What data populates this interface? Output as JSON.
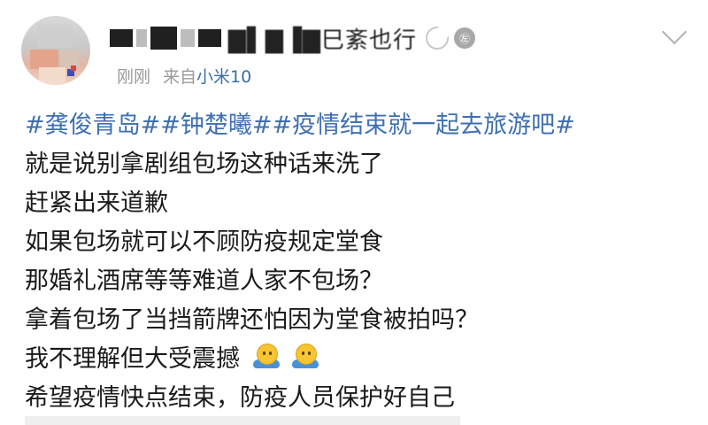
{
  "post": {
    "author": {
      "display_name": "▇▌▇▐▇巳紊也行",
      "avatar_icon": "avatar-icon"
    },
    "badges": [
      "moon-badge-icon",
      "medal-badge-icon"
    ],
    "medal_label": "㊧",
    "menu_icon": "chevron-down-icon",
    "time": "刚刚",
    "source_prefix": "来自",
    "source_device": "小米10",
    "hashtags": "#龚俊青岛##钟楚曦##疫情结束就一起去旅游吧#",
    "lines": [
      "就是说别拿剧组包场这种话来洗了",
      "赶紧出来道歉",
      "如果包场就可以不顾防疫规定堂食",
      "那婚礼酒席等等难道人家不包场？",
      "拿着包场了当挡箭牌还怕因为堂食被拍吗？",
      "我不理解但大受震撼",
      "希望疫情快点结束，防疫人员保护好自己"
    ],
    "emoji": [
      "shrug-emoji-icon",
      "shrug-emoji-icon"
    ]
  },
  "colors": {
    "hashtag": "#3f6fb0",
    "device_link": "#3a6ea5",
    "meta_text": "#9a9a9a",
    "body_text": "#1a1a1a"
  }
}
